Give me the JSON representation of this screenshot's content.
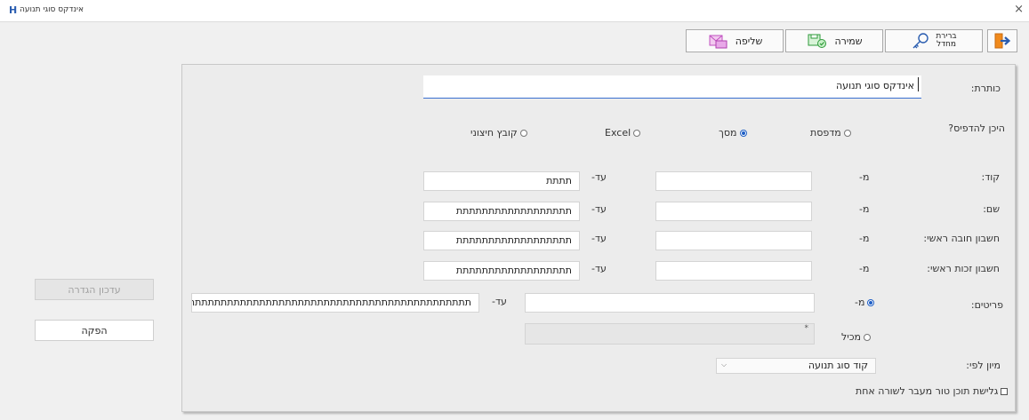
{
  "window": {
    "title": "אינדקס סוגי תנועה",
    "app_icon": "H",
    "close_glyph": "×"
  },
  "toolbar": {
    "exit_icon": "exit-door-icon",
    "default_label_line1": "ברירת",
    "default_label_line2": "מחדל",
    "save_label": "שמירה",
    "fetch_label": "שליפה"
  },
  "side": {
    "update_definition_label": "עדכון הגדרה",
    "produce_label": "הפקה"
  },
  "form": {
    "title_label": "כותרת:",
    "title_value": "אינדקס סוגי תנועה",
    "where_label": "היכן להדפיס?",
    "print_options": [
      "מדפסת",
      "מסך",
      "Excel",
      "קובץ חיצוני"
    ],
    "print_selected": "מסך",
    "from_label": "מ-",
    "to_label": "עד-",
    "rows": [
      {
        "label": "קוד:",
        "from": "",
        "to": "תתתת"
      },
      {
        "label": "שם:",
        "from": "",
        "to": "תתתתתתתתתתתתתתתתתת"
      },
      {
        "label": "חשבון חובה ראשי:",
        "from": "",
        "to": "תתתתתתתתתתתתתתתתתת"
      },
      {
        "label": "חשבון זכות ראשי:",
        "from": "",
        "to": "תתתתתתתתתתתתתתתתתת"
      }
    ],
    "items_label": "פריטים:",
    "items_from_radio": "מ-",
    "items_from_value": "",
    "items_to_label": "עד-",
    "items_to_value": "תתתתתתתתתתתתתתתתתתתתתתתתתתתתתתתתתתתתתתתתתתתתתתתתת",
    "contains_radio": "מכיל",
    "contains_star": "*",
    "sort_label": "מיון לפי:",
    "sort_value": "קוד סוג תנועה",
    "wrap_label": "גלישת תוכן טור מעבר לשורה אחת"
  },
  "colors": {
    "accent": "#1f5fc5",
    "panel": "#ececec",
    "background": "#f0f0f0"
  }
}
